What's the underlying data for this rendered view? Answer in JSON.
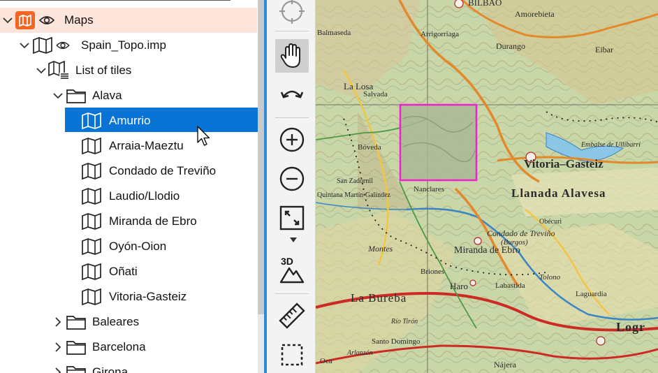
{
  "tree": {
    "root": {
      "label": "Maps",
      "icon": "map-folder-icon"
    },
    "file": {
      "label": "Spain_Topo.imp",
      "icon": "map-icon"
    },
    "tiles": {
      "label": "List of tiles",
      "icon": "tile-list-icon"
    },
    "folders": [
      {
        "label": "Alava",
        "expanded": true,
        "children": [
          {
            "label": "Amurrio",
            "selected": true
          },
          {
            "label": "Arraia-Maeztu"
          },
          {
            "label": "Condado de Treviño"
          },
          {
            "label": "Laudio/Llodio"
          },
          {
            "label": "Miranda de Ebro"
          },
          {
            "label": "Oyón-Oion"
          },
          {
            "label": "Oñati"
          },
          {
            "label": "Vitoria-Gasteiz"
          }
        ]
      },
      {
        "label": "Baleares",
        "expanded": false
      },
      {
        "label": "Barcelona",
        "expanded": false
      },
      {
        "label": "Girona",
        "expanded": false
      }
    ]
  },
  "toolbar": {
    "tools": [
      {
        "name": "gps-crosshair-icon"
      },
      {
        "name": "pan-hand-icon",
        "active": true
      },
      {
        "name": "undo-icon"
      },
      {
        "name": "zoom-in-icon"
      },
      {
        "name": "zoom-out-icon"
      },
      {
        "name": "fit-view-icon"
      },
      {
        "name": "view-3d-icon",
        "label": "3D"
      },
      {
        "name": "ruler-icon"
      },
      {
        "name": "select-rect-icon"
      }
    ]
  },
  "map": {
    "labels": [
      "BILBAO",
      "Amorebieta",
      "Durango",
      "Eibar",
      "Arrigorriaga",
      "Balmaseda",
      "La Losa",
      "Vitoria–Gasteiz",
      "Llanada Alavesa",
      "Condado de Treviño",
      "(Burgos)",
      "Miranda de Ebro",
      "Haro",
      "La Bureba",
      "Logr",
      "Montes",
      "Tolono",
      "Salvada",
      "Nájera",
      "Santo Domingo",
      "Bóveda",
      "San Zadornil",
      "Quintana Martín Galíndez",
      "Embalse de Ullíbarri",
      "Arlanzón",
      "Oca",
      "Río Tirón",
      "Laguardia",
      "Labastida",
      "Obécuri",
      "Briones",
      "Nanclares"
    ],
    "highlight_color": "#ee22cc"
  },
  "colors": {
    "root_bg": "#fde5dc",
    "selection": "#0a74d6",
    "splitter": "#2e8ad8",
    "map_folder_icon": "#f26522"
  }
}
